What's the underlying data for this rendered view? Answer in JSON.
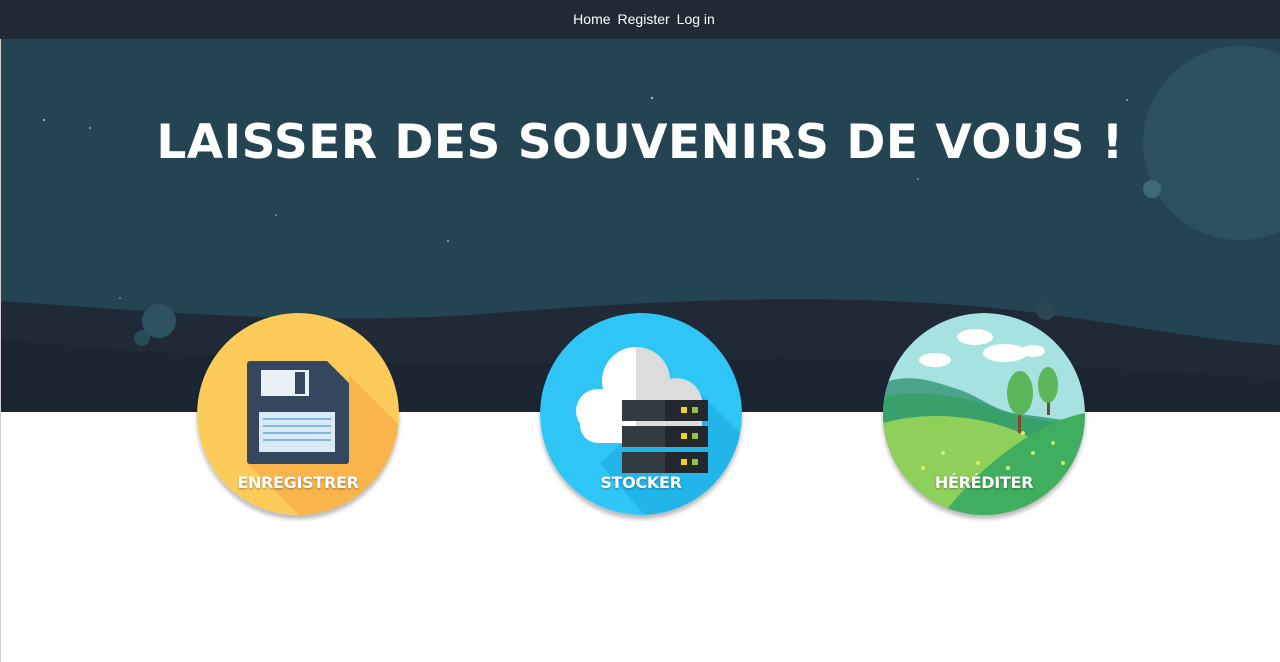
{
  "nav": {
    "items": [
      {
        "label": "Home"
      },
      {
        "label": "Register"
      },
      {
        "label": "Log in"
      }
    ]
  },
  "hero": {
    "title": "LAISSER DES SOUVENIRS DE VOUS !"
  },
  "features": [
    {
      "label": "ENREGISTRER",
      "icon": "floppy-disk-icon",
      "color": "#FDCB5A"
    },
    {
      "label": "STOCKER",
      "icon": "cloud-server-icon",
      "color": "#2FC5F6"
    },
    {
      "label": "HÉRÉDITER",
      "icon": "landscape-icon",
      "color": "#A6E2DF"
    }
  ],
  "colors": {
    "navbar": "#1F2A36",
    "hero": "#244452",
    "hill": "#1F2A36",
    "text": "#FFFFFF"
  }
}
